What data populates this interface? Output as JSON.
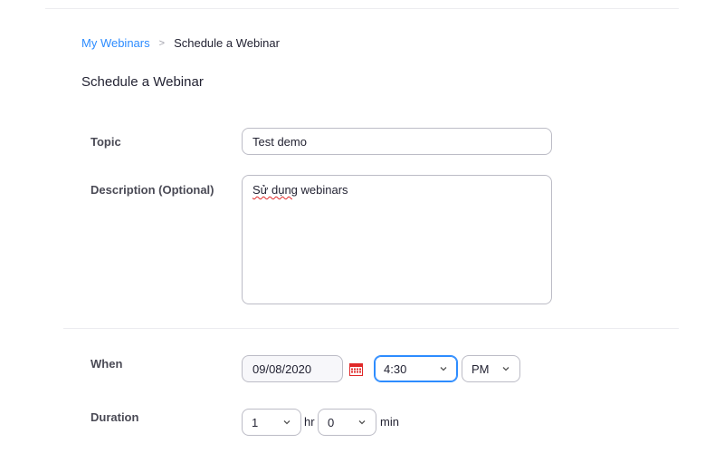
{
  "breadcrumb": {
    "parent": "My Webinars",
    "separator": ">",
    "current": "Schedule a Webinar"
  },
  "page_title": "Schedule a Webinar",
  "form": {
    "topic": {
      "label": "Topic",
      "value": "Test demo"
    },
    "description": {
      "label": "Description (Optional)",
      "value_misspelled": "Sử dụng",
      "value_rest": " webinars"
    },
    "when": {
      "label": "When",
      "date": "09/08/2020",
      "calendar_icon": "calendar-icon",
      "time": "4:30",
      "ampm": "PM"
    },
    "duration": {
      "label": "Duration",
      "hours": "1",
      "hours_unit": "hr",
      "minutes": "0",
      "minutes_unit": "min"
    }
  },
  "colors": {
    "link": "#2d8cff",
    "focus_border": "#2d8cff",
    "calendar_icon": "#e02828",
    "spellcheck": "#e02828"
  }
}
